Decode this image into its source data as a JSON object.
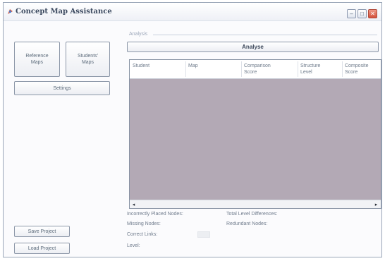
{
  "window": {
    "title": "Concept Map Assistance",
    "min_glyph": "–",
    "max_glyph": "□",
    "close_glyph": "✕",
    "title_icon": "app-logo-icon"
  },
  "left_panel": {
    "reference_maps_line1": "Reference",
    "reference_maps_line2": "Maps",
    "students_maps_line1": "Students'",
    "students_maps_line2": "Maps",
    "settings_label": "Settings",
    "save_project_label": "Save Project",
    "load_project_label": "Load Project"
  },
  "analysis": {
    "group_label": "Analysis",
    "analyse_button": "Analyse",
    "columns": [
      {
        "line1": "Student",
        "line2": ""
      },
      {
        "line1": "Map",
        "line2": ""
      },
      {
        "line1": "Comparison",
        "line2": "Score"
      },
      {
        "line1": "Structure",
        "line2": "Level"
      },
      {
        "line1": "Composite",
        "line2": "Score"
      }
    ],
    "scroll_left": "◂",
    "scroll_right": "▸"
  },
  "details": {
    "incorrectly_placed_nodes": "Incorrectly Placed Nodes:",
    "missing_nodes": "Missing Nodes:",
    "correct_links": "Correct Links:",
    "level": "Level:",
    "total_level_differences": "Total Level Differences:",
    "redundant_nodes": "Redundant Nodes:"
  },
  "colors": {
    "grid_background": "#b3a9b5",
    "close_button": "#d3503a",
    "border": "#8c97a8"
  }
}
